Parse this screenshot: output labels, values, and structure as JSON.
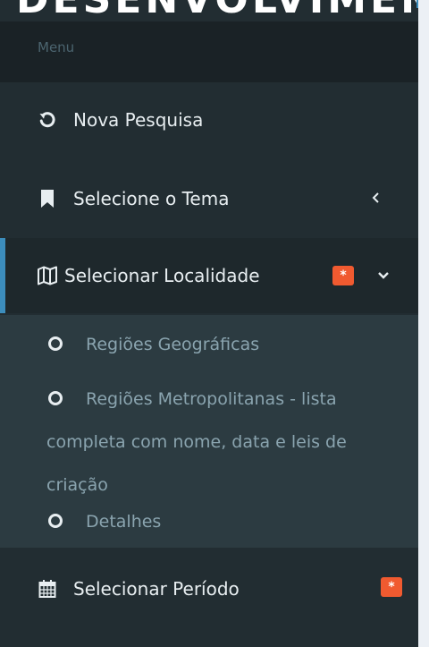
{
  "colors": {
    "sidebar_bg": "#222d32",
    "menu_header_bg": "#1a2226",
    "submenu_bg": "#2c3b41",
    "accent": "#3c8dbc",
    "badge": "#f05a30",
    "text": "#e8eef1",
    "sub_text": "#8aa4af"
  },
  "logo_text": "DESENVOLVIMENTO",
  "menu_header": "Menu",
  "nav": {
    "nova_pesquisa": {
      "label": "Nova Pesquisa",
      "icon": "undo-icon"
    },
    "selecione_tema": {
      "label": "Selecione o Tema",
      "icon": "bookmark-icon",
      "chevron": "chevron-left-icon"
    },
    "selecionar_localidade": {
      "label": "Selecionar Localidade",
      "icon": "map-icon",
      "badge": "*",
      "chevron": "chevron-down-icon"
    },
    "selecionar_periodo": {
      "label": "Selecionar Período",
      "icon": "calendar-icon",
      "badge": "*"
    }
  },
  "submenu": [
    {
      "label": "Regiões Geográficas",
      "icon": "circle-icon"
    },
    {
      "label": "Regiões Metropolitanas - lista completa com nome, data e leis de criação",
      "icon": "circle-icon"
    },
    {
      "label": "Detalhes",
      "icon": "circle-icon"
    }
  ]
}
